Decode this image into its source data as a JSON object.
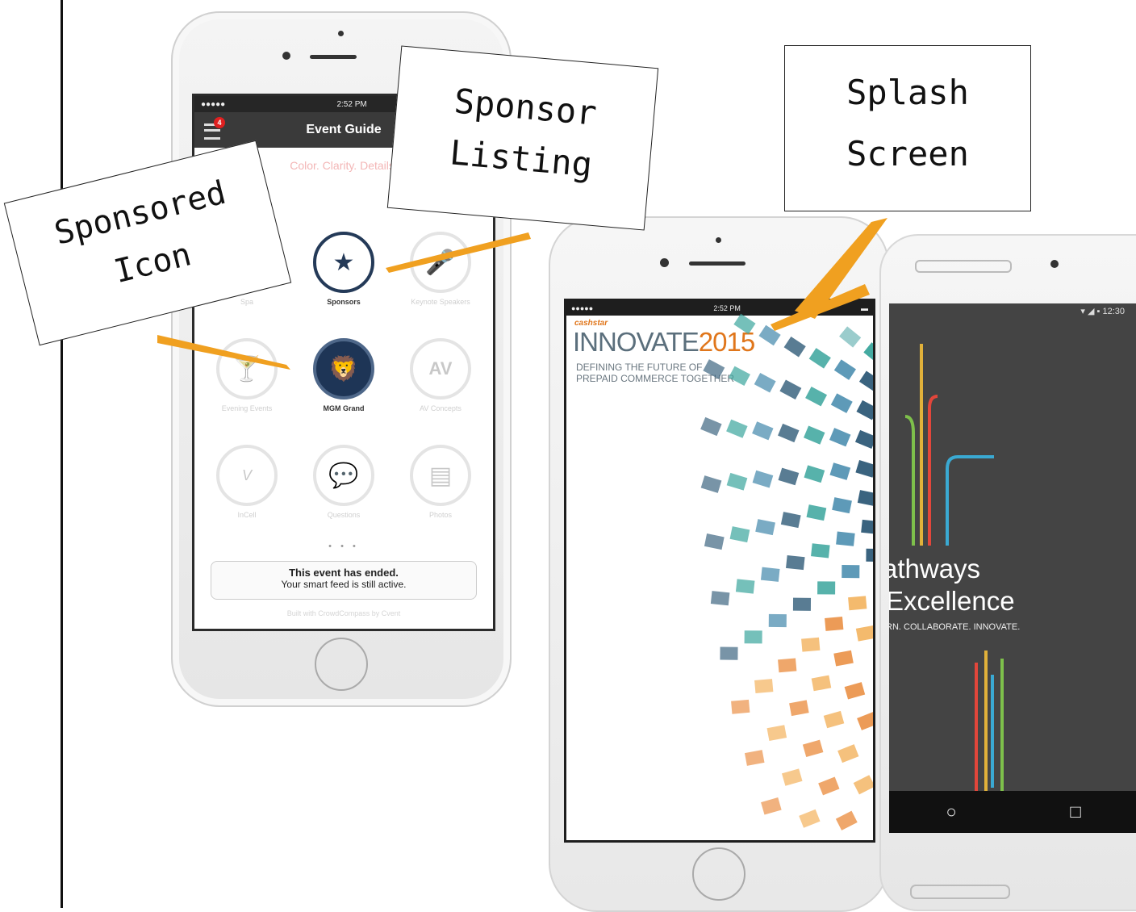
{
  "callouts": {
    "sponsored_icon": [
      "Sponsored",
      "Icon"
    ],
    "sponsor_listing": [
      "Sponsor",
      "Listing"
    ],
    "splash_screen": [
      "Splash",
      "Screen"
    ]
  },
  "event_guide_phone": {
    "status_time": "2:52 PM",
    "nav_title": "Event Guide",
    "notification_count": "4",
    "faded_header": "Color. Clarity. Details.",
    "tiles": [
      {
        "label": "Spa",
        "style": "faded",
        "icon": "spa-icon"
      },
      {
        "label": "Sponsors",
        "style": "active",
        "icon": "sponsors-icon"
      },
      {
        "label": "Keynote Speakers",
        "style": "faded",
        "icon": "microphone-icon"
      },
      {
        "label": "Evening Events",
        "style": "faded",
        "icon": "cocktail-icon"
      },
      {
        "label": "MGM Grand",
        "style": "sponsored",
        "icon": "lion-icon"
      },
      {
        "label": "AV Concepts",
        "style": "faded",
        "icon": "av-logo-icon"
      },
      {
        "label": "InCell",
        "style": "faded",
        "icon": "vegas-icon"
      },
      {
        "label": "Questions",
        "style": "faded",
        "icon": "speech-bubbles-icon"
      },
      {
        "label": "Photos",
        "style": "faded",
        "icon": "photos-icon"
      }
    ],
    "page_dots": "• • •",
    "ended_title": "This event has ended.",
    "ended_subtitle": "Your smart feed is still active.",
    "powered_by": "Built with CrowdCompass by Cvent"
  },
  "splash_phone": {
    "status_time": "2:52 PM",
    "brand": "cashstar",
    "title_word": "INNOVATE",
    "title_year": "2015",
    "tagline_line1": "DEFINING THE FUTURE OF",
    "tagline_line2": "PREPAID COMMERCE TOGETHER",
    "mosaic_colors": [
      "#d5531a",
      "#e9893a",
      "#f3b25d",
      "#2f5b78",
      "#4d8fb0",
      "#3aa59c",
      "#8fc7c6",
      "#a8d4e6"
    ]
  },
  "android_phone": {
    "status_time": "12:30",
    "title_line1": "athways",
    "title_line2": "Excellence",
    "subtitle": "RN. COLLABORATE. INNOVATE.",
    "nav_home": "○",
    "nav_recent": "□",
    "line_colors": [
      "#e1b13a",
      "#7ec04b",
      "#e2463b",
      "#3aa9d2"
    ]
  },
  "colors": {
    "arrow": "#f0a020",
    "navy": "#1e3556"
  }
}
